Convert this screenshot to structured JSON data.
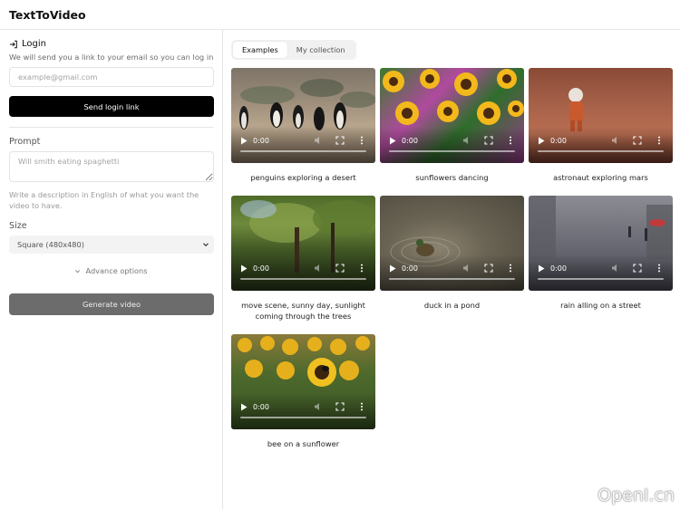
{
  "app": {
    "title": "TextToVideo"
  },
  "login": {
    "title": "Login",
    "subtitle": "We will send you a link to your email so you can log in",
    "email_placeholder": "example@gmail.com",
    "button": "Send login link"
  },
  "form": {
    "prompt_label": "Prompt",
    "prompt_placeholder": "Will smith eating spaghetti",
    "prompt_hint": "Write a description in English of what you want the video to have.",
    "size_label": "Size",
    "size_value": "Square (480x480)",
    "advance_label": "Advance options",
    "generate_button": "Generate video"
  },
  "tabs": [
    {
      "label": "Examples",
      "active": true
    },
    {
      "label": "My collection",
      "active": false
    }
  ],
  "videos": [
    {
      "caption": "penguins exploring a desert",
      "time": "0:00"
    },
    {
      "caption": "sunflowers dancing",
      "time": "0:00"
    },
    {
      "caption": "astronaut exploring mars",
      "time": "0:00"
    },
    {
      "caption": "move scene, sunny day, sunlight coming through the trees",
      "time": "0:00"
    },
    {
      "caption": "duck in a pond",
      "time": "0:00"
    },
    {
      "caption": "rain alling on a street",
      "time": "0:00"
    },
    {
      "caption": "bee on a sunflower",
      "time": "0:00"
    }
  ],
  "watermark": "OpenI.cn",
  "colors": {
    "primary_button": "#000000",
    "generate_button": "#6c6c6c",
    "border": "#e5e5e5"
  }
}
